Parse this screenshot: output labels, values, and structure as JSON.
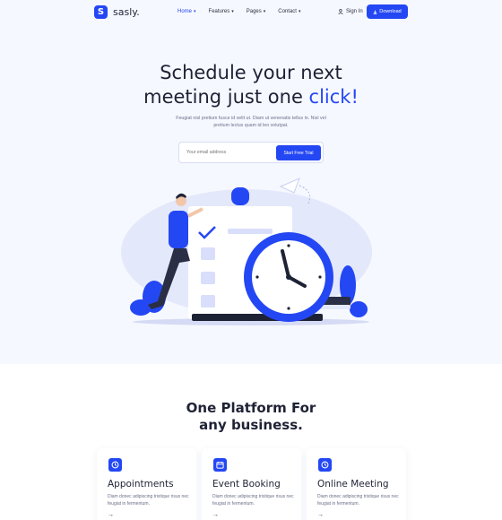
{
  "brand": {
    "name": "sasly.",
    "mark": "S",
    "accent": "#2447f4"
  },
  "nav": {
    "items": [
      {
        "label": "Home",
        "active": true
      },
      {
        "label": "Features",
        "active": false
      },
      {
        "label": "Pages",
        "active": false
      },
      {
        "label": "Contact",
        "active": false
      }
    ],
    "signin_label": "Sign In",
    "download_label": "Download"
  },
  "hero": {
    "title_line1": "Schedule your next",
    "title_line2_prefix": "meeting just one ",
    "title_line2_accent": "click!",
    "subtitle": "Feugiat nisl pretium fusce id velit ut. Diam ut venenatis tellus in. Nisl vel pretium lectus quam id leo volutpat.",
    "email_placeholder": "Your email address",
    "cta_label": "Start Free Trial"
  },
  "section2": {
    "title_line1": "One Platform For",
    "title_line2": "any business.",
    "cards": [
      {
        "title": "Appointments",
        "text": "Diam donec adipiscing tristique risus nec feugiat in fermentum.",
        "icon": "clock-icon"
      },
      {
        "title": "Event Booking",
        "text": "Diam donec adipiscing tristique risus nec feugiat in fermentum.",
        "icon": "calendar-icon"
      },
      {
        "title": "Online Meeting",
        "text": "Diam donec adipiscing tristique risus nec feugiat in fermentum.",
        "icon": "clock-icon"
      }
    ]
  }
}
